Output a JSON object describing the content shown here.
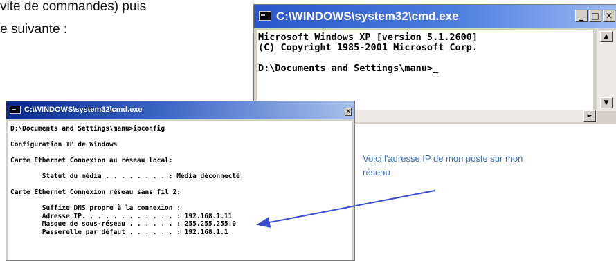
{
  "document": {
    "line1": "vite de commandes) puis",
    "line2": "e suivante :"
  },
  "window_top": {
    "title": "C:\\WINDOWS\\system32\\cmd.exe",
    "buttons": {
      "minimize": "_",
      "maximize": "□",
      "close": "✕"
    },
    "lines": [
      "Microsoft Windows XP [version 5.1.2600]",
      "(C) Copyright 1985-2001 Microsoft Corp.",
      "",
      "D:\\Documents and Settings\\manu>_"
    ]
  },
  "window_bottom": {
    "title": "C:\\WINDOWS\\system32\\cmd.exe",
    "lines": [
      "D:\\Documents and Settings\\manu>ipconfig",
      "",
      "Configuration IP de Windows",
      "",
      "Carte Ethernet Connexion au réseau local:",
      "",
      "        Statut du média . . . . . . . . : Média déconnecté",
      "",
      "Carte Ethernet Connexion réseau sans fil 2:",
      "",
      "        Suffixe DNS propre à la connexion :",
      "        Adresse IP. . . . . . . . . . . . : 192.168.1.11",
      "        Masque de sous-réseau . . . . . . : 255.255.255.0",
      "        Passerelle par défaut . . . . . . : 192.168.1.1"
    ]
  },
  "annotation": {
    "text": "Voici l'adresse IP de mon poste sur mon réseau",
    "color": "#3c6fc4"
  },
  "colors": {
    "arrow": "#3a4fd0",
    "titlebar_blue": "#2b57c9"
  }
}
